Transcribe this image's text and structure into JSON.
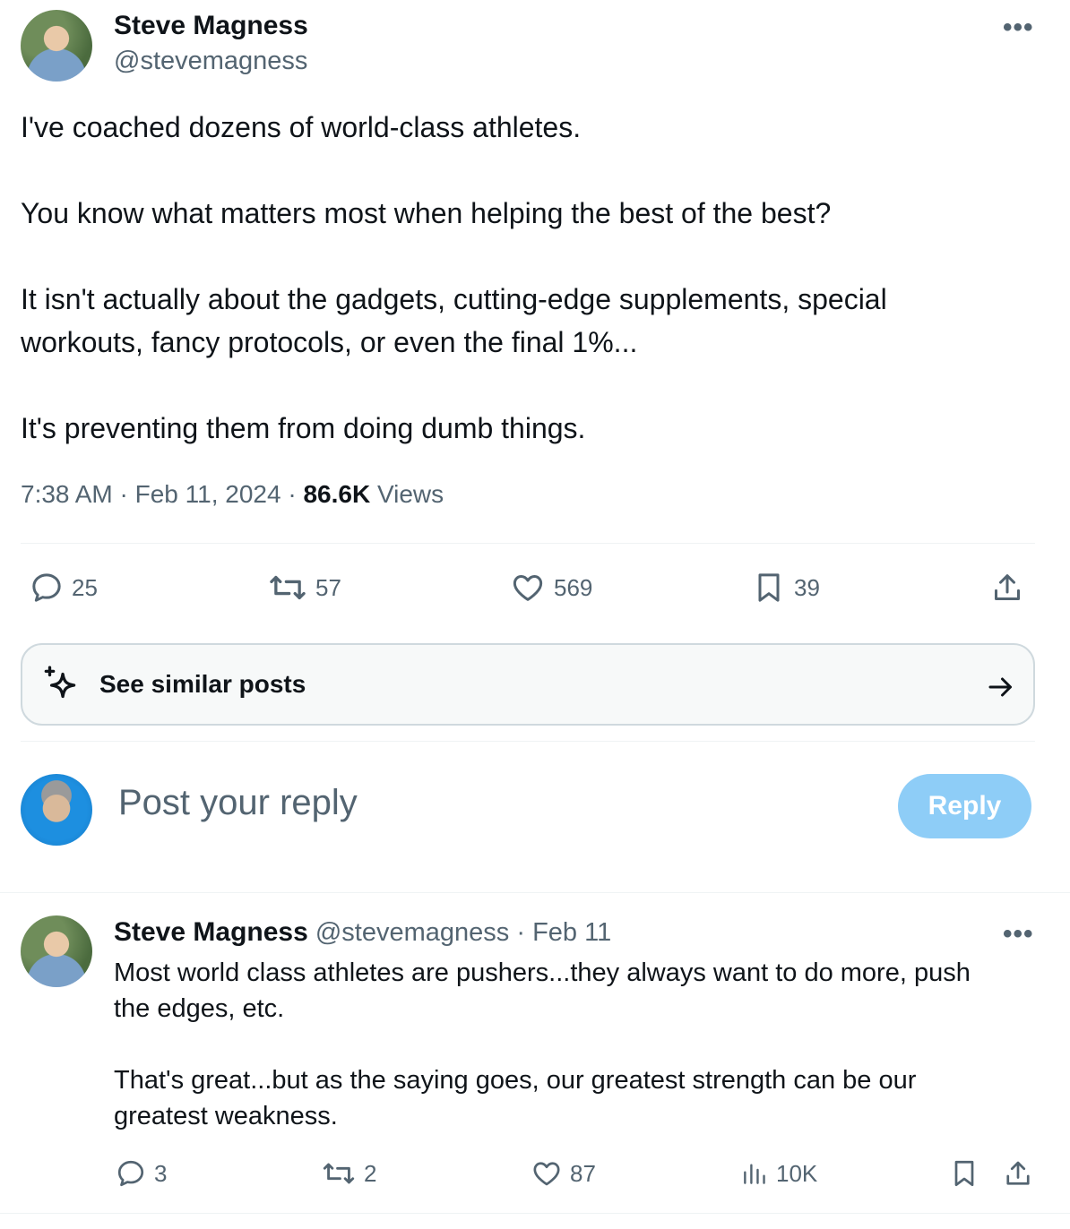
{
  "main_post": {
    "author_name": "Steve Magness",
    "author_handle": "@stevemagness",
    "more_icon": "more-horizontal-icon",
    "text_p1": "I've coached dozens of world-class athletes.",
    "text_p2": "You know what matters most when helping the best of the best?",
    "text_p3": "It isn't actually about the gadgets, cutting-edge supplements, special\nworkouts, fancy protocols, or even the final 1%...",
    "text_p4": "It's preventing them from doing dumb things.",
    "time": "7:38 AM",
    "date": "Feb 11, 2024",
    "views_count": "86.6K",
    "views_label": "Views",
    "replies": "25",
    "reposts": "57",
    "likes": "569",
    "bookmarks": "39"
  },
  "similar": {
    "label": "See similar posts",
    "icon": "sparkle-icon"
  },
  "composer": {
    "placeholder": "Post your reply",
    "button": "Reply"
  },
  "reply_post": {
    "author_name": "Steve Magness",
    "author_handle": "@stevemagness",
    "date": "Feb 11",
    "text_p1": "Most world class athletes are pushers...they always want to do more, push\nthe edges, etc.",
    "text_p2": "That's great...but as the saying goes, our greatest strength can be our\ngreatest weakness.",
    "replies": "3",
    "reposts": "2",
    "likes": "87",
    "views": "10K"
  },
  "colors": {
    "accent_disabled": "#8ecdf7",
    "secondary_text": "#536471",
    "divider": "#eff3f4"
  }
}
